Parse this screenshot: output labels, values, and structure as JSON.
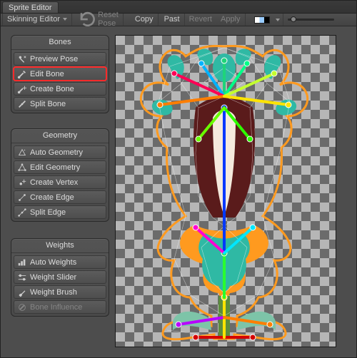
{
  "window": {
    "title": "Sprite Editor"
  },
  "toolbar": {
    "mode_label": "Skinning Editor",
    "reset_pose": "Reset Pose",
    "copy": "Copy",
    "paste": "Paste",
    "paste_alt": "Past",
    "revert": "Revert",
    "apply": "Apply"
  },
  "panels": {
    "bones": {
      "title": "Bones",
      "items": [
        {
          "label": "Preview Pose",
          "icon": "preview-pose-icon"
        },
        {
          "label": "Edit Bone",
          "icon": "edit-bone-icon",
          "highlighted": true
        },
        {
          "label": "Create Bone",
          "icon": "create-bone-icon"
        },
        {
          "label": "Split Bone",
          "icon": "split-bone-icon"
        }
      ]
    },
    "geometry": {
      "title": "Geometry",
      "items": [
        {
          "label": "Auto Geometry",
          "icon": "auto-geometry-icon"
        },
        {
          "label": "Edit Geometry",
          "icon": "edit-geometry-icon"
        },
        {
          "label": "Create Vertex",
          "icon": "create-vertex-icon"
        },
        {
          "label": "Create Edge",
          "icon": "create-edge-icon"
        },
        {
          "label": "Split Edge",
          "icon": "split-edge-icon"
        }
      ]
    },
    "weights": {
      "title": "Weights",
      "items": [
        {
          "label": "Auto Weights",
          "icon": "auto-weights-icon"
        },
        {
          "label": "Weight Slider",
          "icon": "weight-slider-icon"
        },
        {
          "label": "Weight Brush",
          "icon": "weight-brush-icon"
        },
        {
          "label": "Bone Influence",
          "icon": "bone-influence-icon",
          "disabled": true
        }
      ]
    }
  },
  "bone_colors": {
    "root": "#d40000",
    "stalk_low": "#ffe400",
    "stalk_mid": "#29ff2e",
    "body": "#0038ff",
    "teeth_l": "#ff00d4",
    "teeth_r": "#00e7ff",
    "leaf_l": "#b800ff",
    "leaf_r": "#ff7e00",
    "eye_l": "#6aff00",
    "eye_r": "#2dff00",
    "petal0": "#ff0055",
    "petal1": "#00b3ff",
    "petal2": "#00ff88",
    "petal3": "#1fd47a",
    "petal4": "#c4ff2e"
  }
}
